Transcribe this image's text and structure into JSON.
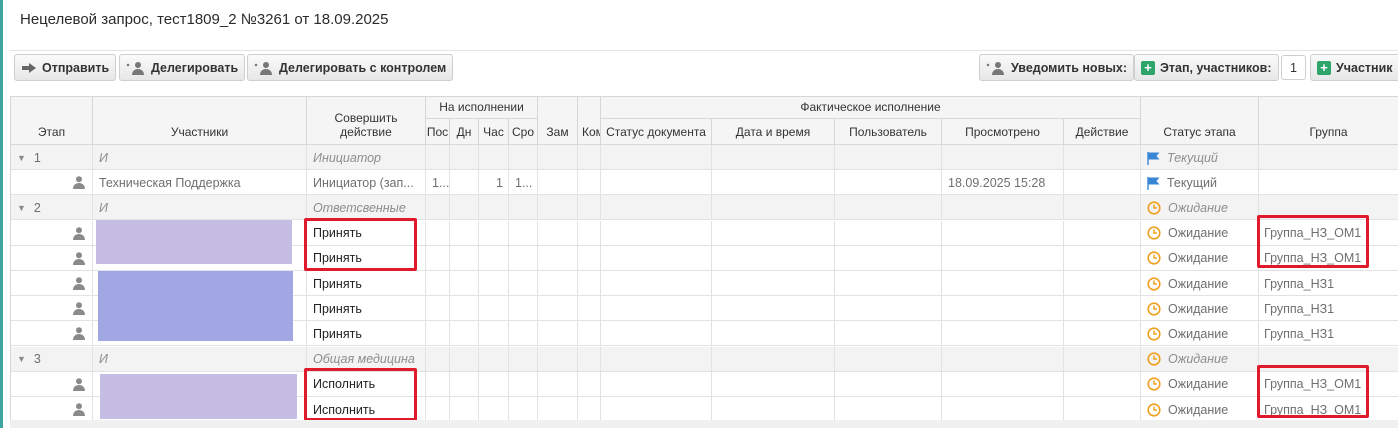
{
  "window": {
    "title": "Нецелевой запрос, тест1809_2 №3261 от 18.09.2025"
  },
  "toolbar": {
    "send_label": "Отправить",
    "delegate_label": "Делегировать",
    "delegate_control_label": "Делегировать с контролем",
    "notify_new_label": "Уведомить новых:",
    "stage_participants_label": "Этап, участников:",
    "participants_count": "1",
    "participant_label": "Участник"
  },
  "columns": {
    "stage": "Этап",
    "participants": "Участники",
    "action": "Совершить действие",
    "on_execution": "На исполнении",
    "on_exec_cols": [
      "Пос",
      "Дн",
      "Час",
      "Сро"
    ],
    "deputy": "Зам",
    "comment": "Ком",
    "actual_execution": "Фактическое исполнение",
    "actual_cols": [
      "Статус документа",
      "Дата и время",
      "Пользователь",
      "Просмотрено",
      "Действие"
    ],
    "stage_status": "Статус этапа",
    "group": "Группа"
  },
  "rows": [
    {
      "type": "group",
      "stage": "1",
      "participants": "И",
      "action": "Инициатор",
      "status": "Текущий",
      "status_icon": "flag-icon",
      "group": ""
    },
    {
      "type": "participant",
      "participants": "Техническая Поддержка",
      "action": "Инициатор (зап...",
      "pos": "1...",
      "days": "",
      "hours": "1",
      "term": "1...",
      "viewed": "18.09.2025 15:28",
      "status": "Текущий",
      "status_icon": "flag-icon",
      "group": ""
    },
    {
      "type": "group",
      "stage": "2",
      "participants": "И",
      "action": "Ответсвенные",
      "status": "Ожидание",
      "status_icon": "clock-icon",
      "group": ""
    },
    {
      "type": "participant",
      "participants": "",
      "action": "Принять",
      "status": "Ожидание",
      "status_icon": "clock-icon",
      "group": "Группа_НЗ_ОМ1"
    },
    {
      "type": "participant",
      "participants": "",
      "action": "Принять",
      "status": "Ожидание",
      "status_icon": "clock-icon",
      "group": "Группа_НЗ_ОМ1"
    },
    {
      "type": "participant",
      "participants": "",
      "action": "Принять",
      "status": "Ожидание",
      "status_icon": "clock-icon",
      "group": "Группа_НЗ1"
    },
    {
      "type": "participant",
      "participants": "",
      "action": "Принять",
      "status": "Ожидание",
      "status_icon": "clock-icon",
      "group": "Группа_НЗ1"
    },
    {
      "type": "participant",
      "participants": "",
      "action": "Принять",
      "status": "Ожидание",
      "status_icon": "clock-icon",
      "group": "Группа_НЗ1"
    },
    {
      "type": "group",
      "stage": "3",
      "participants": "И",
      "action": "Общая медицина",
      "status": "Ожидание",
      "status_icon": "clock-icon",
      "group": ""
    },
    {
      "type": "participant",
      "participants": "",
      "action": "Исполнить",
      "status": "Ожидание",
      "status_icon": "clock-icon",
      "group": "Группа_НЗ_ОМ1"
    },
    {
      "type": "participant",
      "participants": "",
      "action": "Исполнить",
      "status": "Ожидание",
      "status_icon": "clock-icon",
      "group": "Группа_НЗ_ОМ1"
    }
  ],
  "colors": {
    "accent": "#3fa5a0",
    "highlight": "#e0192b",
    "redact_light": "#c6bde4",
    "redact_dark": "#a0a7e3",
    "flag": "#3a86d6",
    "clock": "#f0a020"
  }
}
